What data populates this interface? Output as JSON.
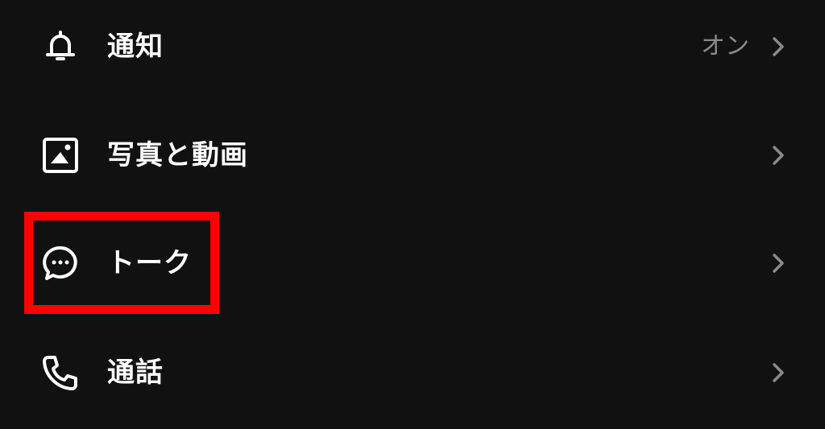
{
  "settings": {
    "notifications": {
      "label": "通知",
      "value": "オン",
      "icon": "bell-icon"
    },
    "photos_videos": {
      "label": "写真と動画",
      "icon": "image-icon"
    },
    "chats": {
      "label": "トーク",
      "icon": "chat-bubble-icon"
    },
    "calls": {
      "label": "通話",
      "icon": "phone-icon"
    }
  },
  "colors": {
    "background": "#111111",
    "text": "#ffffff",
    "value_text": "#8a8a8a",
    "chevron": "#8a8a8a",
    "highlight": "#ff0000"
  }
}
